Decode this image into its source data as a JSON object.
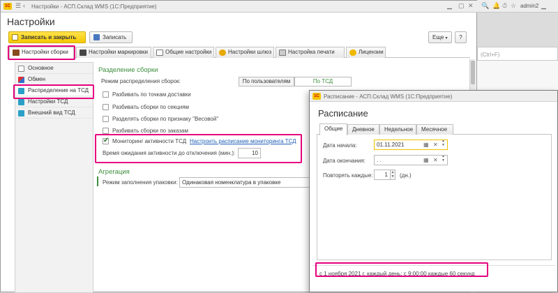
{
  "main_window": {
    "title": "Настройки - АСП.Склад WMS  (1С:Предприятие)",
    "logo": "1С",
    "page_title": "Настройки",
    "toolbar": {
      "save_close": "Записать и закрыть",
      "save": "Записать",
      "more": "Еще",
      "help": "?"
    },
    "tabs": [
      {
        "label": "Настройки сборки"
      },
      {
        "label": "Настройки маркировки"
      },
      {
        "label": "Общие настройки"
      },
      {
        "label": "Настройки шлюз"
      },
      {
        "label": "Настройка печати"
      },
      {
        "label": "Лицензии"
      }
    ],
    "left_nav": [
      {
        "label": "Основное"
      },
      {
        "label": "Обмен"
      },
      {
        "label": "Распределение на ТСД"
      },
      {
        "label": "Настройки ТСД"
      },
      {
        "label": "Внешний вид ТСД"
      }
    ],
    "assembly": {
      "section_title": "Разделение сборки",
      "mode_label": "Режим распределения сборок:",
      "mode_options": [
        "По пользователям",
        "По ТСД"
      ],
      "checkboxes": [
        {
          "label": "Разбивать по точкам доставки",
          "checked": false
        },
        {
          "label": "Разбивать сборки по секциям",
          "checked": false
        },
        {
          "label": "Разделять сборки по признаку \"Весовой\"",
          "checked": false
        },
        {
          "label": "Разбивать сборки по заказам",
          "checked": false
        }
      ],
      "monitoring_label": "Мониторинг активности ТСД",
      "monitoring_checked": true,
      "schedule_link": "Настроить расписание мониторинга ТСД",
      "wait_label": "Время ожидания активности до отключения (мин.):",
      "wait_value": "10"
    },
    "aggregation": {
      "section_title": "Агрегация",
      "pack_mode_label": "Режим заполнения упаковки:",
      "pack_mode_value": "Одинаковая номенклатура в упаковке"
    }
  },
  "background_window": {
    "user": "admin2",
    "search_hint": "(Ctrl+F)"
  },
  "dialog": {
    "title": "Расписание - АСП.Склад WMS  (1С:Предприятие)",
    "heading": "Расписание",
    "tabs": [
      {
        "label": "Общие"
      },
      {
        "label": "Дневное"
      },
      {
        "label": "Недельное"
      },
      {
        "label": "Месячное"
      }
    ],
    "start_label": "Дата начала:",
    "start_value": "01.11.2021",
    "end_label": "Дата окончания:",
    "end_value": " .  .",
    "repeat_label": "Повторять каждые:",
    "repeat_value": "1",
    "repeat_unit": "(дн.)",
    "summary": "с 1 ноября 2021 г. каждый день; с 9:00:00 каждые 60 секунд"
  },
  "colors": {
    "highlight": "#e6007e",
    "accent_yellow": "#f4c800",
    "section_green": "#3c8d3c",
    "link_blue": "#1f5fb6"
  }
}
